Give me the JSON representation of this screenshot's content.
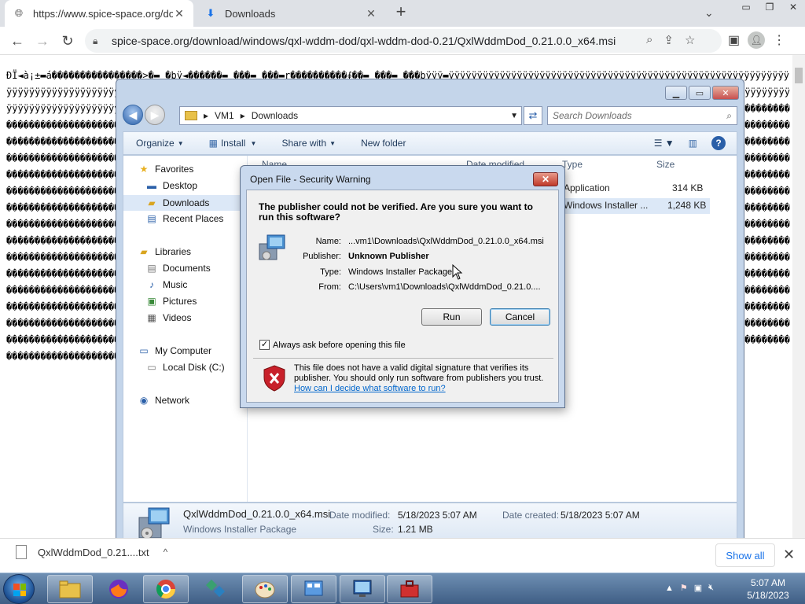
{
  "browser": {
    "tabs": [
      {
        "title": "https://www.spice-space.org/dov",
        "icon": "globe-icon"
      },
      {
        "title": "Downloads",
        "icon": "download-icon"
      }
    ],
    "url": "spice-space.org/download/windows/qxl-wddm-dod/qxl-wddm-dod-0.21/QxlWddmDod_0.21.0.0_x64.msi"
  },
  "page": {
    "garbage_text": "ÐÏ◄à¡±▬á����������������>�▬ �þÿ◄������▬ ���▬ ���▬r����������∮��▬ ���▬ ���þÿÿÿ▬ÿÿÿÿÿÿÿÿÿÿÿÿÿÿÿÿÿÿÿÿÿÿÿÿÿÿÿÿÿÿÿÿÿÿÿÿÿÿÿÿÿÿÿÿÿÿÿÿÿÿÿÿÿÿÿÿÿÿÿÿÿÿÿÿÿÿÿÿÿÿÿÿÿÿÿÿÿÿÿÿÿÿÿÿÿÿÿÿÿÿÿÿÿÿÿÿÿÿÿÿÿÿÿÿÿÿÿÿÿÿÿÿÿÿÿÿÿÿÿÿÿÿÿÿÿÿÿÿÿÿÿÿÿÿÿÿÿÿÿÿÿÿÿÿÿÿÿÿÿÿÿÿÿÿÿÿÿÿÿÿÿÿÿÿÿÿÿÿÿÿÿÿÿÿÿÿÿÿÿÿÿÿÿÿÿÿÿÿÿÿÿÿÿÿÿÿÿÿÿÿÿÿÿÿÿÿÿÿÿÿÿÿÿÿÿÿÿÿÿÿÿÿÿÿÿÿÿÿÿÿÿÿÿÿÿÿÿÿÿÿÿÿÿÿÿÿÿÿÿÿÿÿÿÿÿÿÿÿÿÿÿÿÿÿÿÿÿÿÿÿÿÿÿÿÿÿÿÿ�����������������������������������������������������������������������������������������������������������������������������������������������������������������������������������������������������������������������������������������������������������������������������������������������������������������������������������������������������������������������������������������������������������������������������������������������������������������������������������������������������������������������������������������������������������������������������������������������������������������������������������������������������������������������������������������������������������������������������������������������������������������������������������������������������������������������������������������������������������������������������������������������������������������������������������������������������������������������������������������������������������������������������������������������������������������������������������������������������������������������������������������������������������������������������������������������������������������������������������������������������������������������������������������������������������������������������������������������������������������������������������������������������������������������������������������������������������������������������������������������������������������������������������������������������������������������������������������������������������������������������������������������������������������������������������������������������������������������������������������������������������������������������������������������������������������������������������������������������������������������������������������������������������������������������������������������������������������������������������������������������������������������������������������������������������������������������������������������������������������������"
  },
  "download_shelf": {
    "item_label": "QxlWddmDod_0.21....txt",
    "show_all": "Show all"
  },
  "explorer": {
    "breadcrumb": [
      "VM1",
      "Downloads"
    ],
    "search_placeholder": "Search Downloads",
    "commands": {
      "organize": "Organize",
      "install": "Install",
      "share_with": "Share with",
      "new_folder": "New folder"
    },
    "nav": {
      "favorites": "Favorites",
      "desktop": "Desktop",
      "downloads": "Downloads",
      "recent_places": "Recent Places",
      "libraries": "Libraries",
      "documents": "Documents",
      "music": "Music",
      "pictures": "Pictures",
      "videos": "Videos",
      "my_computer": "My Computer",
      "local_disk": "Local Disk (C:)",
      "network": "Network"
    },
    "columns": [
      "Name",
      "Date modified",
      "Type",
      "Size"
    ],
    "rows": [
      {
        "type": "Application",
        "size": "314 KB"
      },
      {
        "type": "Windows Installer ...",
        "size": "1,248 KB"
      }
    ],
    "details": {
      "filename": "QxlWddmDod_0.21.0.0_x64.msi",
      "filetype": "Windows Installer Package",
      "date_modified_label": "Date modified:",
      "date_modified": "5/18/2023 5:07 AM",
      "date_created_label": "Date created:",
      "date_created": "5/18/2023 5:07 AM",
      "size_label": "Size:",
      "size": "1.21 MB"
    }
  },
  "dialog": {
    "title": "Open File - Security Warning",
    "heading": "The publisher could not be verified.  Are you sure you want to run this software?",
    "name_label": "Name:",
    "name_value": "...vm1\\Downloads\\QxlWddmDod_0.21.0.0_x64.msi",
    "publisher_label": "Publisher:",
    "publisher_value": "Unknown Publisher",
    "type_label": "Type:",
    "type_value": "Windows Installer Package",
    "from_label": "From:",
    "from_value": "C:\\Users\\vm1\\Downloads\\QxlWddmDod_0.21.0....",
    "run": "Run",
    "cancel": "Cancel",
    "checkbox_label": "Always ask before opening this file",
    "checkbox_checked": true,
    "warning_text": "This file does not have a valid digital signature that verifies its publisher.  You should only run software from publishers you trust.",
    "warning_link": "How can I decide what software to run?"
  },
  "taskbar": {
    "time": "5:07 AM",
    "date": "5/18/2023"
  }
}
